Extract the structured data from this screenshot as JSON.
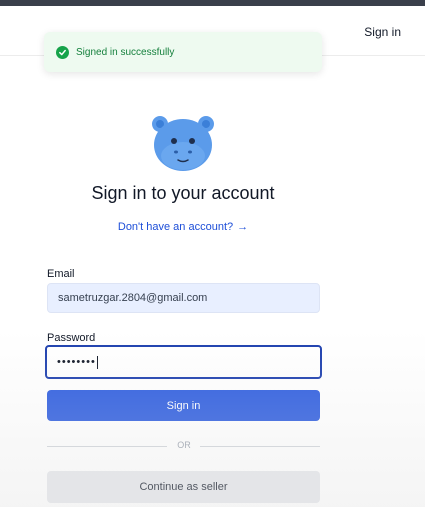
{
  "header": {
    "signin_label": "Sign in"
  },
  "toast": {
    "message": "Signed in successfully",
    "icon": "check-circle-icon",
    "color": "#16a34a"
  },
  "logo": {
    "icon": "hippo-logo-icon",
    "color": "#5b9bea"
  },
  "form": {
    "title": "Sign in to your account",
    "signup_link": "Don't have an account?",
    "signup_arrow": "→",
    "email_label": "Email",
    "email_value": "sametruzgar.2804@gmail.com",
    "password_label": "Password",
    "password_value": "••••••••",
    "submit_label": "Sign in",
    "divider_text": "OR",
    "seller_label": "Continue as seller"
  },
  "colors": {
    "primary": "#2f5ee0",
    "link": "#1d4ed8",
    "focus_border": "#1e40af",
    "email_bg": "#e8efff"
  }
}
